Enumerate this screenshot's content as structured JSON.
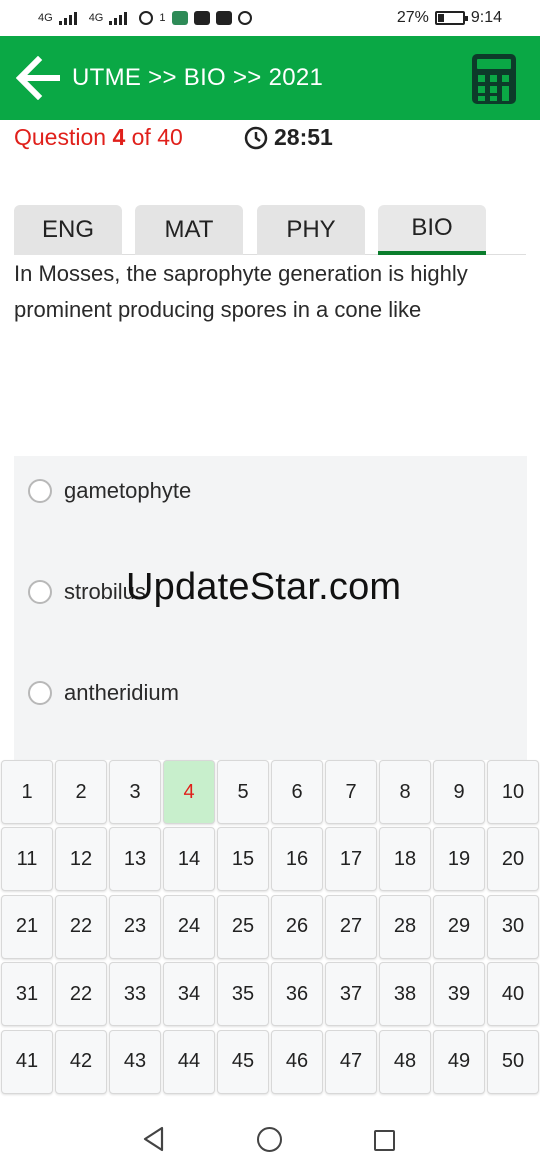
{
  "status_bar": {
    "network_labels": [
      "4G",
      "4G"
    ],
    "notification_badge": "1",
    "battery": "27%",
    "battery_level": 0.27,
    "time": "9:14"
  },
  "app_bar": {
    "title": "UTME >> BIO >> 2021",
    "back_icon": "arrow-left-icon",
    "calculator_icon": "calculator-icon",
    "color": "#0aa845"
  },
  "question": {
    "label_prefix": "Question ",
    "number": "4",
    "label_suffix": " of 40",
    "timer": "28:51",
    "text": "In Mosses, the saprophyte generation is highly prominent producing spores in a cone like"
  },
  "tabs": [
    {
      "label": "ENG",
      "active": false
    },
    {
      "label": "MAT",
      "active": false
    },
    {
      "label": "PHY",
      "active": false
    },
    {
      "label": "BIO",
      "active": true
    }
  ],
  "options": [
    {
      "label": "gametophyte"
    },
    {
      "label": "strobilus"
    },
    {
      "label": "antheridium"
    }
  ],
  "watermark": "UpdateStar.com",
  "question_grid": {
    "current": "4",
    "rows": [
      [
        "1",
        "2",
        "3",
        "4",
        "5",
        "6",
        "7",
        "8",
        "9",
        "10"
      ],
      [
        "11",
        "12",
        "13",
        "14",
        "15",
        "16",
        "17",
        "18",
        "19",
        "20"
      ],
      [
        "21",
        "22",
        "23",
        "24",
        "25",
        "26",
        "27",
        "28",
        "29",
        "30"
      ],
      [
        "31",
        "22",
        "33",
        "34",
        "35",
        "36",
        "37",
        "38",
        "39",
        "40"
      ],
      [
        "41",
        "42",
        "43",
        "44",
        "45",
        "46",
        "47",
        "48",
        "49",
        "50"
      ]
    ]
  },
  "nav_bar": {
    "back_icon": "triangle-back-icon",
    "home_icon": "circle-home-icon",
    "recents_icon": "square-recents-icon"
  },
  "colors": {
    "accent_green": "#0aa845",
    "tab_underline": "#0a7d2c",
    "question_red": "#e0201b",
    "current_cell": "#c8efcc"
  }
}
